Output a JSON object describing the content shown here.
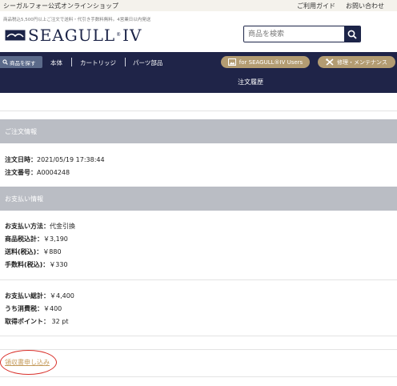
{
  "topbar": {
    "shop_name": "シーガルフォー公式オンラインショップ",
    "guide": "ご利用ガイド",
    "contact": "お問い合わせ"
  },
  "notice": "商品税込5,500円以上ご注文で送料・代引き手数料無料。4営業日以内発送",
  "logo": {
    "text": "SEAGULL",
    "reg": "®",
    "suffix": "IV"
  },
  "search": {
    "placeholder": "商品を検索"
  },
  "nav": {
    "search_tab": "商品を探す",
    "items": [
      "本体",
      "カートリッジ",
      "パーツ部品"
    ],
    "users_button": "for SEAGULL®IV Users",
    "maintenance_button": "修理・メンテナンス",
    "page_title": "注文履歴"
  },
  "order_info": {
    "heading": "ご注文情報",
    "date_label": "注文日時：",
    "date_value": "2021/05/19 17:38:44",
    "number_label": "注文番号：",
    "number_value": "A0004248"
  },
  "payment_info": {
    "heading": "お支払い情報",
    "method_label": "お支払い方法：",
    "method_value": "代金引換",
    "subtotal_label": "商品税込計：",
    "subtotal_value": "￥3,190",
    "shipping_label": "送料(税込)：",
    "shipping_value": "￥880",
    "fee_label": "手数料(税込)：",
    "fee_value": "￥330",
    "total_label": "お支払い総計：",
    "total_value": "￥4,400",
    "tax_label": "うち消費税：",
    "tax_value": "￥400",
    "points_label": "取得ポイント：",
    "points_value": " 32 pt"
  },
  "receipt_link": "領収書申し込み",
  "colors": {
    "navy": "#1f2448",
    "gold": "#b39c72",
    "section_gray": "#babdc4",
    "link": "#c49a5a",
    "highlight": "#d9302a"
  },
  "icons": [
    "search-icon",
    "seagull-logo-icon",
    "image-icon",
    "tools-icon"
  ]
}
